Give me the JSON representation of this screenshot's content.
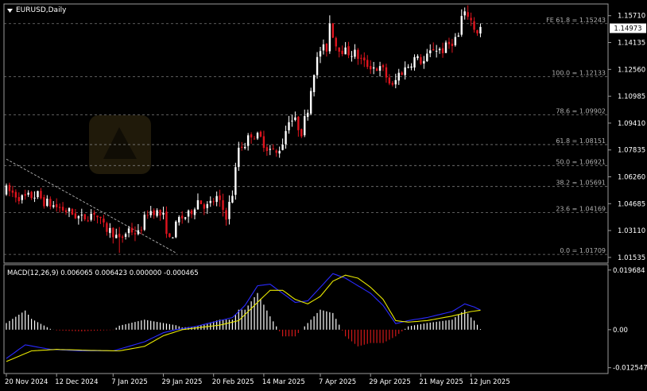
{
  "window": {
    "symbol_title": "EURUSD,Daily",
    "current_price": "1.14973"
  },
  "colors": {
    "background": "#000000",
    "bull": "#ffffff",
    "bear": "#e0141e",
    "fib_line": "#7a7a7a",
    "macd_line": "#2a2aff",
    "signal_line": "#e8e800",
    "hist_pos": "#ffffff",
    "hist_neg": "#d01818",
    "price_tag_bg": "#ffffff",
    "price_tag_text": "#000000"
  },
  "chart_data": [
    {
      "type": "candlestick",
      "title": "EURUSD,Daily",
      "y_ticks": [
        "1.15710",
        "1.14135",
        "1.12560",
        "1.10985",
        "1.09410",
        "1.07835",
        "1.06260",
        "1.04685",
        "1.03110",
        "1.01535"
      ],
      "ylim": [
        1.0125,
        1.1635
      ],
      "x_ticks": [
        "20 Nov 2024",
        "12 Dec 2024",
        "7 Jan 2025",
        "29 Jan 2025",
        "20 Feb 2025",
        "14 Mar 2025",
        "7 Apr 2025",
        "29 Apr 2025",
        "21 May 2025",
        "12 Jun 2025"
      ],
      "x_tick_bar_index": [
        0,
        16,
        34,
        50,
        66,
        82,
        100,
        116,
        132,
        148
      ],
      "fibonacci_levels": [
        {
          "label": "FE 61.8 = 1.15243",
          "value": 1.15243
        },
        {
          "label": "100.0 = 1.12133",
          "value": 1.12133
        },
        {
          "label": "78.6 = 1.09902",
          "value": 1.09902
        },
        {
          "label": "61.8 = 1.08151",
          "value": 1.08151
        },
        {
          "label": "50.0 = 1.06921",
          "value": 1.06921
        },
        {
          "label": "38.2 = 1.05691",
          "value": 1.05691
        },
        {
          "label": "23.6 = 1.04169",
          "value": 1.04169
        },
        {
          "label": "0.0 = 1.01709",
          "value": 1.01709
        }
      ],
      "trendline": {
        "from": [
          0,
          1.073
        ],
        "to": [
          54,
          1.018
        ],
        "style": "dashed"
      },
      "waypoints_close": [
        [
          0,
          1.055
        ],
        [
          5,
          1.05
        ],
        [
          10,
          1.052
        ],
        [
          12,
          1.048
        ],
        [
          16,
          1.045
        ],
        [
          20,
          1.042
        ],
        [
          24,
          1.038
        ],
        [
          28,
          1.042
        ],
        [
          31,
          1.033
        ],
        [
          34,
          1.03
        ],
        [
          36,
          1.025
        ],
        [
          39,
          1.032
        ],
        [
          42,
          1.029
        ],
        [
          45,
          1.042
        ],
        [
          47,
          1.043
        ],
        [
          50,
          1.039
        ],
        [
          52,
          1.025
        ],
        [
          55,
          1.038
        ],
        [
          58,
          1.04
        ],
        [
          61,
          1.049
        ],
        [
          64,
          1.045
        ],
        [
          67,
          1.05
        ],
        [
          70,
          1.04
        ],
        [
          72,
          1.053
        ],
        [
          74,
          1.08
        ],
        [
          76,
          1.082
        ],
        [
          78,
          1.088
        ],
        [
          81,
          1.085
        ],
        [
          83,
          1.08
        ],
        [
          86,
          1.076
        ],
        [
          88,
          1.083
        ],
        [
          90,
          1.097
        ],
        [
          92,
          1.095
        ],
        [
          94,
          1.089
        ],
        [
          96,
          1.103
        ],
        [
          98,
          1.125
        ],
        [
          100,
          1.137
        ],
        [
          102,
          1.138
        ],
        [
          103,
          1.153
        ],
        [
          105,
          1.14
        ],
        [
          108,
          1.136
        ],
        [
          111,
          1.135
        ],
        [
          114,
          1.129
        ],
        [
          117,
          1.127
        ],
        [
          120,
          1.125
        ],
        [
          122,
          1.118
        ],
        [
          123,
          1.115
        ],
        [
          125,
          1.123
        ],
        [
          127,
          1.126
        ],
        [
          130,
          1.132
        ],
        [
          133,
          1.13
        ],
        [
          136,
          1.138
        ],
        [
          139,
          1.137
        ],
        [
          142,
          1.142
        ],
        [
          144,
          1.145
        ],
        [
          145,
          1.156
        ],
        [
          147,
          1.158
        ],
        [
          149,
          1.15
        ],
        [
          150,
          1.148
        ],
        [
          151,
          1.1497
        ]
      ],
      "fixed_extremes_high": [
        [
          103,
          1.1573
        ],
        [
          147,
          1.1632
        ]
      ],
      "fixed_extremes_low": [
        [
          36,
          1.018
        ]
      ]
    },
    {
      "type": "line",
      "title": "MACD(12,26,9) 0.006065 0.006423 0.000000 -0.000465",
      "y_ticks": [
        "0.019684",
        "0.00",
        "-0.012547"
      ],
      "ylim": [
        -0.0142,
        0.0212
      ],
      "series": [
        {
          "name": "main",
          "role": "macd",
          "waypoints": [
            [
              0,
              -0.0095
            ],
            [
              6,
              -0.005
            ],
            [
              14,
              -0.0065
            ],
            [
              24,
              -0.007
            ],
            [
              34,
              -0.007
            ],
            [
              44,
              -0.004
            ],
            [
              50,
              -0.001
            ],
            [
              54,
              0.0
            ],
            [
              60,
              0.001
            ],
            [
              66,
              0.0025
            ],
            [
              72,
              0.004
            ],
            [
              76,
              0.008
            ],
            [
              80,
              0.0145
            ],
            [
              84,
              0.015
            ],
            [
              88,
              0.012
            ],
            [
              92,
              0.009
            ],
            [
              96,
              0.0095
            ],
            [
              100,
              0.014
            ],
            [
              104,
              0.0185
            ],
            [
              108,
              0.017
            ],
            [
              112,
              0.0145
            ],
            [
              116,
              0.012
            ],
            [
              120,
              0.008
            ],
            [
              124,
              0.002
            ],
            [
              128,
              0.003
            ],
            [
              134,
              0.004
            ],
            [
              142,
              0.006
            ],
            [
              146,
              0.0085
            ],
            [
              149,
              0.0075
            ],
            [
              151,
              0.0065
            ]
          ]
        },
        {
          "name": "signal",
          "role": "signal",
          "waypoints": [
            [
              0,
              -0.0105
            ],
            [
              8,
              -0.007
            ],
            [
              16,
              -0.0065
            ],
            [
              26,
              -0.0068
            ],
            [
              36,
              -0.007
            ],
            [
              44,
              -0.0055
            ],
            [
              50,
              -0.002
            ],
            [
              56,
              0.0
            ],
            [
              62,
              0.0008
            ],
            [
              68,
              0.0015
            ],
            [
              74,
              0.003
            ],
            [
              80,
              0.009
            ],
            [
              84,
              0.013
            ],
            [
              88,
              0.013
            ],
            [
              92,
              0.01
            ],
            [
              96,
              0.0085
            ],
            [
              100,
              0.011
            ],
            [
              104,
              0.016
            ],
            [
              108,
              0.018
            ],
            [
              112,
              0.017
            ],
            [
              116,
              0.014
            ],
            [
              120,
              0.01
            ],
            [
              124,
              0.003
            ],
            [
              128,
              0.0025
            ],
            [
              134,
              0.003
            ],
            [
              142,
              0.0045
            ],
            [
              148,
              0.006
            ],
            [
              151,
              0.0064
            ]
          ]
        }
      ]
    }
  ]
}
